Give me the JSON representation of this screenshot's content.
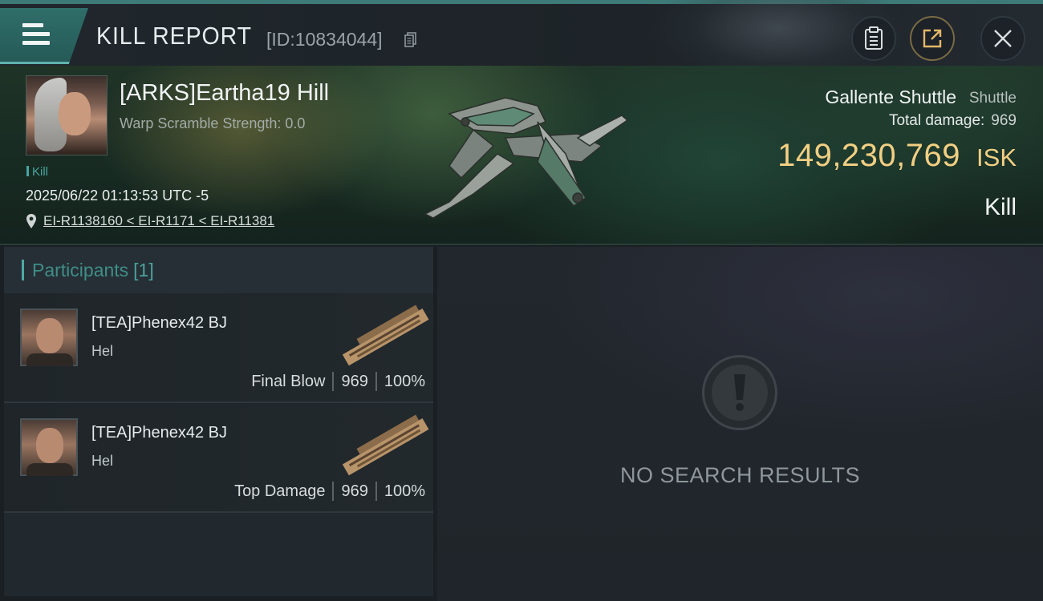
{
  "header": {
    "title": "KILL REPORT",
    "report_id": "[ID:10834044]"
  },
  "victim": {
    "name": "[ARKS]Eartha19 Hill",
    "warp_scramble": "Warp Scramble Strength: 0.0",
    "tag": "Kill",
    "timestamp": "2025/06/22 01:13:53 UTC -5",
    "location": "EI-R1138160 < EI-R1171 < EI-R11381"
  },
  "ship": {
    "name": "Gallente Shuttle",
    "class": "Shuttle",
    "total_damage_label": "Total damage:",
    "total_damage": "969",
    "isk_value": "149,230,769",
    "isk_unit": "ISK",
    "result": "Kill"
  },
  "participants": {
    "label": "Participants",
    "count": "[1]",
    "items": [
      {
        "name": "[TEA]Phenex42 BJ",
        "ship": "Hel",
        "role": "Final Blow",
        "damage": "969",
        "percent": "100%"
      },
      {
        "name": "[TEA]Phenex42 BJ",
        "ship": "Hel",
        "role": "Top Damage",
        "damage": "969",
        "percent": "100%"
      }
    ]
  },
  "results": {
    "empty_text": "NO SEARCH RESULTS"
  },
  "colors": {
    "accent_teal": "#4fa9a1",
    "isk_gold": "#f1cf83",
    "menu_teal": "#2f6e6a"
  },
  "icons": [
    "menu-icon",
    "copy-icon",
    "clipboard-icon",
    "share-icon",
    "close-icon",
    "location-pin-icon",
    "exclamation-icon"
  ]
}
